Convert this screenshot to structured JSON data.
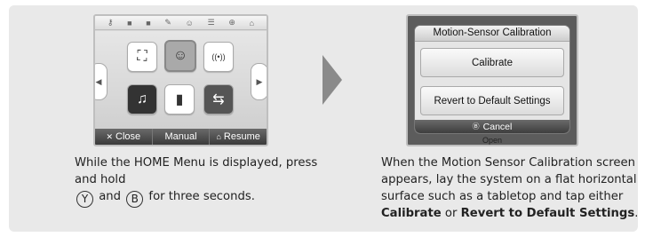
{
  "step1": {
    "topbar_icons": [
      "⚷",
      "■",
      "■",
      "✎",
      "☺",
      "☰",
      "⊕",
      "⌂"
    ],
    "tiles": [
      "⛶",
      "☺",
      "((•))",
      "♫",
      "▮",
      "⇆"
    ],
    "bottom_bar": {
      "close_icon": "✕",
      "close_label": "Close",
      "manual_label": "Manual",
      "resume_icon": "⌂",
      "resume_label": "Resume"
    },
    "caption_part1": "While the HOME Menu is displayed, press and hold",
    "button_y": "Y",
    "caption_and": "and",
    "button_b": "B",
    "caption_part2": "for three seconds."
  },
  "step2": {
    "dialog_title": "Motion-Sensor Calibration",
    "calibrate_label": "Calibrate",
    "revert_label": "Revert to Default Settings",
    "cancel_icon": "Ⓑ",
    "cancel_label": "Cancel",
    "under_text": "Open",
    "caption_part1": "When the Motion Sensor Calibration screen appears, lay the system on a flat horizontal sur­face such as a tabletop and tap either",
    "caption_bold1": "Calibrate",
    "caption_or": "or",
    "caption_bold2": "Revert to Default Settings",
    "caption_end": "."
  },
  "colors": {
    "panel_bg": "#e9e9e9",
    "arrow": "#8a8a8a",
    "bar_dark": "#3a3a3a"
  }
}
